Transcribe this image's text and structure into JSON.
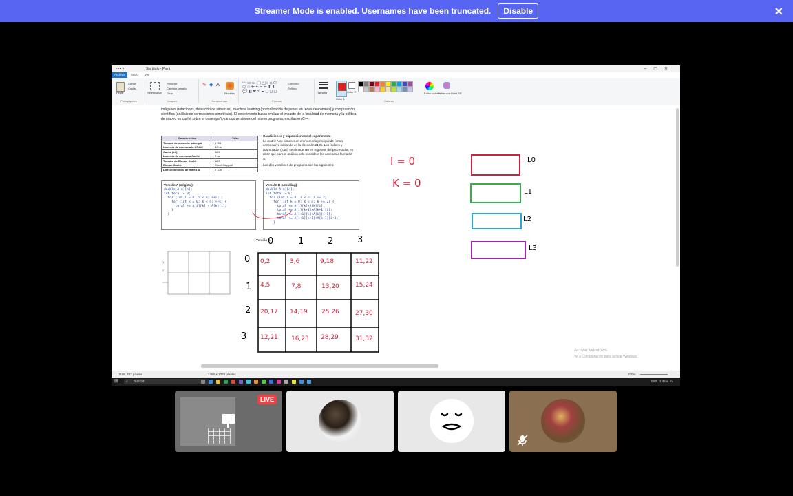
{
  "banner": {
    "message": "Streamer Mode is enabled. Usernames have been truncated.",
    "disable_label": "Disable",
    "close_icon": "close-icon",
    "bg": "#5865f2"
  },
  "paint": {
    "title": "Sin título - Paint",
    "tabs": [
      "Archivo",
      "Inicio",
      "Ver"
    ],
    "ribbon_groups": [
      "Portapapeles",
      "Imagen",
      "Herramientas",
      "Formas",
      "Colores"
    ],
    "ribbon_buttons": {
      "paste": "Pegar",
      "cut": "Cortar",
      "copy": "Copiar",
      "select": "Seleccionar",
      "crop": "Recortar",
      "resize": "Cambiar tamaño",
      "rotate": "Girar",
      "brushes": "Pinceles",
      "outline": "Contorno",
      "fill": "Relleno",
      "size": "Tamaño",
      "color1": "Color 1",
      "color2": "Color 2",
      "edit_colors": "Editar colores",
      "paint3d": "Editar con Paint 3D"
    },
    "status": {
      "cursor": "1188, 382 píxeles",
      "size": "1456 × 1328 píxeles",
      "zoom": "100%"
    }
  },
  "document": {
    "intro": "imágenes (rotaciones, detección de simetrías), machine learning (normalización de pesos en redes neuronales) y computación científica (análisis de correlaciones simétricas). El experimento busca evaluar el impacto de la localidad de memoria y la política de mapeo en caché sobre el desempeño de dos versiones del mismo programa, escritas en C++.",
    "table_header": [
      "Característica",
      "Valor"
    ],
    "table_rows": [
      [
        "Tamaño de memoria principal",
        "1 GB"
      ],
      [
        "Latencia de acceso a la DRAM",
        "40 ns"
      ],
      [
        "Caché (L1)",
        "16 B"
      ],
      [
        "Latencia de acceso a Caché",
        "2 ns"
      ],
      [
        "Tamaño de Bloque Caché",
        "16 B"
      ],
      [
        "Bloque Caché",
        "Direct Mapped"
      ],
      [
        "Dirección inicial de matriz A",
        "2 10h"
      ]
    ],
    "conditions_title": "Condiciones y suposiciones del experimento",
    "conditions_body": "La matriz A se almacenan en memoria principal de forma consecutiva iniciando en la dirección 210h. Los índices y acumulador (total) se almacenan en registros del procesador, es decir que para el análisis solo considere los accesos a la matriz A.",
    "conditions_footer": "Las dos versiones de programa son las siguientes:",
    "versionA_title": "Versión A (original):",
    "versionA_code": "double A[n][n];\nint total = 0;\n  for (int i = 0; i < n; ++i) {\n    for (int k = 0; k < n; ++k) {\n      total += A[i][k] + A[k][i];\n    }\n  }",
    "versionB_title": "Versión B (unrolling):",
    "versionB_code": "double A[n][n];\nint total = 0;\n  for (int i = 0; i < n; i += 2)\n    for (int k = 0; k < n; k += 2) {\n      total += A[i][k]+A[k][i];\n      total += A[i][k+1]+A[k+1][i];\n      total += A[i+1][k]+A[k][i+1];\n      total += A[i+1][k+1]+A[k+1][i+1];\n    }",
    "versionA_label": "Versión A"
  },
  "handwriting": {
    "col_headers": [
      "0",
      "1",
      "2",
      "3"
    ],
    "row_headers": [
      "0",
      "1",
      "2",
      "3"
    ],
    "cells": [
      [
        "0,2",
        "3,6",
        "9,18",
        "11,22"
      ],
      [
        "4,5",
        "7,8",
        "13,20",
        "15,24"
      ],
      [
        "20,17",
        "14,19",
        "25,26",
        "27,30"
      ],
      [
        "12,21",
        "16,23",
        "28,29",
        "31,32"
      ]
    ],
    "var_i": "I = 0",
    "var_k": "K = 0",
    "levels": [
      {
        "label": "L0",
        "color": "#d0203c"
      },
      {
        "label": "L1",
        "color": "#34b04a"
      },
      {
        "label": "L2",
        "color": "#2aa8c8"
      },
      {
        "label": "L3",
        "color": "#9c2aa8"
      }
    ]
  },
  "watermark": {
    "line1": "Activar Windows",
    "line2": "Ve a Configuración para activar Windows."
  },
  "taskbar": {
    "search": "Buscar",
    "lang": "ESP",
    "time": "1:45 a. m."
  },
  "participants": [
    {
      "name": "stream-tile",
      "live_label": "LIVE"
    },
    {
      "name": "participant-cat"
    },
    {
      "name": "participant-emoji"
    },
    {
      "name": "participant-muted",
      "muted_icon": "mic-muted-icon"
    }
  ]
}
